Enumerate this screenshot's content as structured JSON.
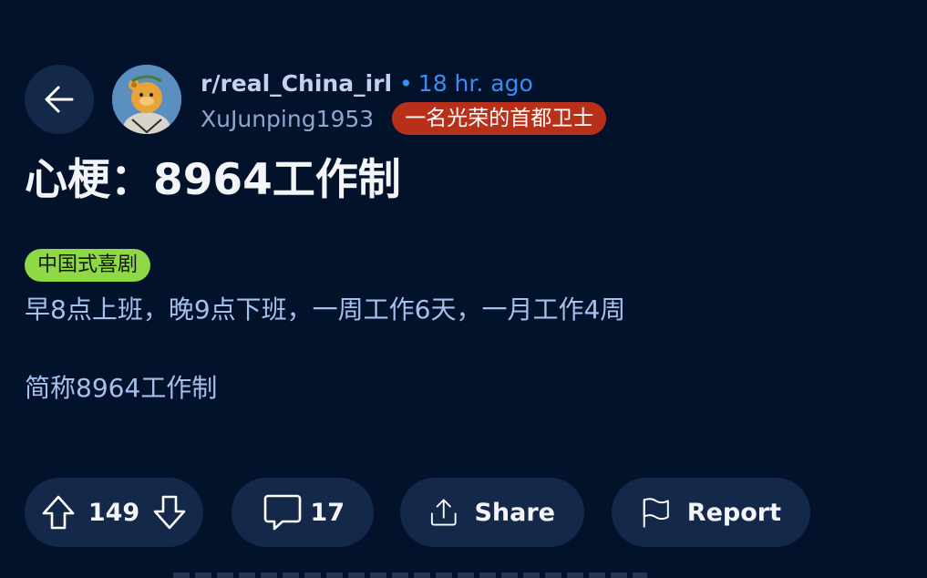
{
  "header": {
    "subreddit": "r/real_China_irl",
    "separator": "•",
    "time_ago": "18 hr. ago",
    "username": "XuJunping1953",
    "user_flair": "一名光荣的首都卫士"
  },
  "post": {
    "title": "心梗：8964工作制",
    "flair": "中国式喜剧",
    "body": [
      "早8点上班，晚9点下班，一周工作6天，一月工作4周",
      "简称8964工作制"
    ]
  },
  "actions": {
    "vote_count": "149",
    "comment_count": "17",
    "share_label": "Share",
    "report_label": "Report"
  },
  "icons": {
    "back": "arrow-left-icon",
    "upvote": "arrow-up-icon",
    "downvote": "arrow-down-icon",
    "comment": "speech-bubble-icon",
    "share": "share-upload-icon",
    "report": "flag-icon"
  },
  "colors": {
    "background": "#03122b",
    "pill": "#14284a",
    "accent_blue": "#3a8df5",
    "user_flair_bg": "#b8301a",
    "post_flair_bg": "#8fd846",
    "body_text": "#a6c0ee"
  }
}
